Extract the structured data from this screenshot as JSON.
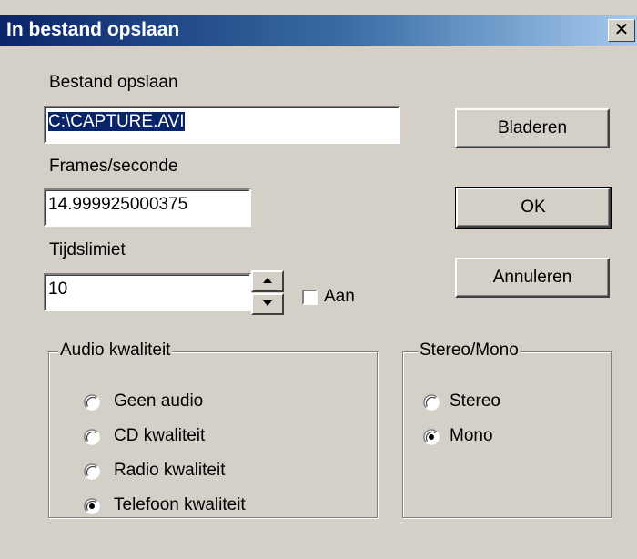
{
  "window": {
    "title": "In bestand opslaan",
    "close_label": "✕"
  },
  "file": {
    "label": "Bestand opslaan",
    "value": "C:\\CAPTURE.AVI"
  },
  "fps": {
    "label": "Frames/seconde",
    "value": "14.999925000375"
  },
  "time_limit": {
    "label": "Tijdslimiet",
    "value": "10",
    "checkbox_label": "Aan",
    "checked": false
  },
  "buttons": {
    "browse": "Bladeren",
    "ok": "OK",
    "cancel": "Annuleren"
  },
  "audio_quality": {
    "title": "Audio kwaliteit",
    "options": [
      "Geen audio",
      "CD kwaliteit",
      "Radio kwaliteit",
      "Telefoon kwaliteit"
    ],
    "selected": "Telefoon kwaliteit"
  },
  "stereo_mono": {
    "title": "Stereo/Mono",
    "options": [
      "Stereo",
      "Mono"
    ],
    "selected": "Mono"
  },
  "icons": [
    "close-icon",
    "arrow-up-icon",
    "arrow-down-icon",
    "radio-icon"
  ]
}
